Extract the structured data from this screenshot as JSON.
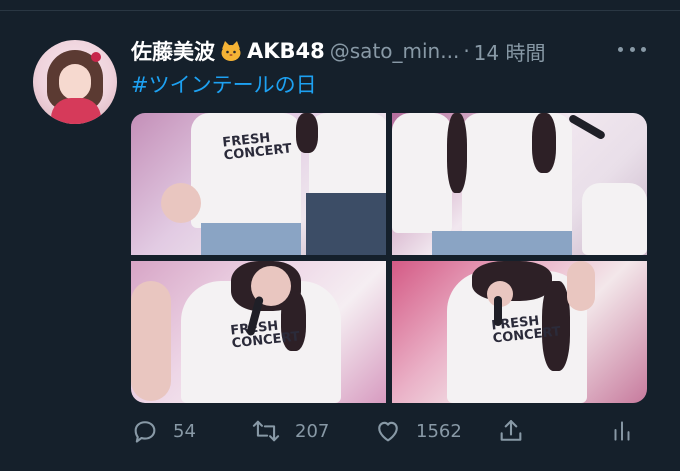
{
  "tweet": {
    "display_name": "佐藤美波",
    "team_name": "AKB48",
    "handle": "@sato_min...",
    "separator": "·",
    "time": "14 時間",
    "hashtag": "#ツインテールの日",
    "name_emoji_icon": "cat-face-icon",
    "more_icon": "more-horizontal-icon"
  },
  "photos": [
    {
      "name": "photo-1",
      "shirt_text": "FRESH\nCONCERT"
    },
    {
      "name": "photo-2",
      "shirt_text": ""
    },
    {
      "name": "photo-3",
      "shirt_text": "FRESH\nCONCERT"
    },
    {
      "name": "photo-4",
      "shirt_text": "FRESH\nCONCERT"
    }
  ],
  "actions": {
    "reply_count": "54",
    "retweet_count": "207",
    "like_count": "1562",
    "reply_icon": "reply-icon",
    "retweet_icon": "retweet-icon",
    "like_icon": "heart-icon",
    "share_icon": "share-icon",
    "analytics_icon": "analytics-icon"
  },
  "colors": {
    "background": "#15202b",
    "accent": "#1da1f2",
    "muted": "#8899a6",
    "name": "#ffffff"
  }
}
